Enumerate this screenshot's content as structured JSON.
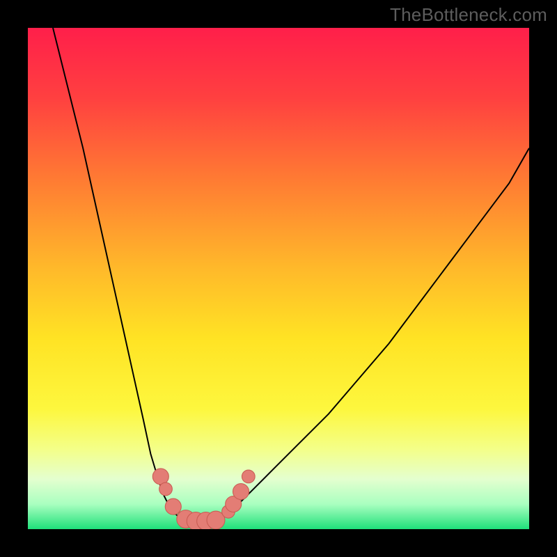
{
  "watermark": {
    "text": "TheBottleneck.com"
  },
  "colors": {
    "frame": "#000000",
    "curve": "#000000",
    "marker_fill": "#e37d75",
    "marker_stroke": "#c95c53"
  },
  "gradient_stops": [
    {
      "pct": 0,
      "color": "#ff1f4a"
    },
    {
      "pct": 14,
      "color": "#ff4040"
    },
    {
      "pct": 30,
      "color": "#ff7a33"
    },
    {
      "pct": 48,
      "color": "#ffb92a"
    },
    {
      "pct": 62,
      "color": "#ffe324"
    },
    {
      "pct": 76,
      "color": "#fdf73e"
    },
    {
      "pct": 84,
      "color": "#f4ff88"
    },
    {
      "pct": 90,
      "color": "#e4ffcf"
    },
    {
      "pct": 95,
      "color": "#aaffc0"
    },
    {
      "pct": 100,
      "color": "#1fe07a"
    }
  ],
  "chart_data": {
    "type": "line",
    "title": "",
    "xlabel": "",
    "ylabel": "",
    "xlim": [
      0,
      100
    ],
    "ylim": [
      0,
      100
    ],
    "note": "Visual-only bottleneck chart with no axes/ticks/legend; values are relative positions read from gradient bands and are approximate.",
    "series": [
      {
        "name": "left_curve",
        "x": [
          5,
          7,
          9,
          11,
          13,
          15,
          17,
          19,
          21,
          23,
          24.5,
          26,
          27,
          28,
          29,
          30,
          31
        ],
        "y": [
          100,
          92,
          84,
          76,
          67,
          58,
          49,
          40,
          31,
          22,
          15,
          10,
          7,
          5,
          3.5,
          2.5,
          2
        ]
      },
      {
        "name": "floor",
        "x": [
          31,
          33,
          35,
          37,
          38.5
        ],
        "y": [
          2,
          1.5,
          1.5,
          1.5,
          2
        ]
      },
      {
        "name": "right_curve",
        "x": [
          38.5,
          40,
          42,
          45,
          49,
          54,
          60,
          66,
          72,
          78,
          84,
          90,
          96,
          100
        ],
        "y": [
          2,
          3,
          5,
          8,
          12,
          17,
          23,
          30,
          37,
          45,
          53,
          61,
          69,
          76
        ]
      }
    ],
    "markers": [
      {
        "series": "left_curve",
        "x": 26.5,
        "y": 10.5,
        "r": 1.6
      },
      {
        "series": "left_curve",
        "x": 27.5,
        "y": 8.0,
        "r": 1.3
      },
      {
        "series": "left_curve",
        "x": 29.0,
        "y": 4.5,
        "r": 1.6
      },
      {
        "series": "floor",
        "x": 31.5,
        "y": 2.0,
        "r": 1.8
      },
      {
        "series": "floor",
        "x": 33.5,
        "y": 1.6,
        "r": 1.8
      },
      {
        "series": "floor",
        "x": 35.5,
        "y": 1.6,
        "r": 1.8
      },
      {
        "series": "floor",
        "x": 37.5,
        "y": 1.8,
        "r": 1.8
      },
      {
        "series": "right_curve",
        "x": 40.0,
        "y": 3.5,
        "r": 1.3
      },
      {
        "series": "right_curve",
        "x": 41.0,
        "y": 5.0,
        "r": 1.6
      },
      {
        "series": "right_curve",
        "x": 42.5,
        "y": 7.5,
        "r": 1.6
      },
      {
        "series": "right_curve",
        "x": 44.0,
        "y": 10.5,
        "r": 1.3
      }
    ]
  }
}
